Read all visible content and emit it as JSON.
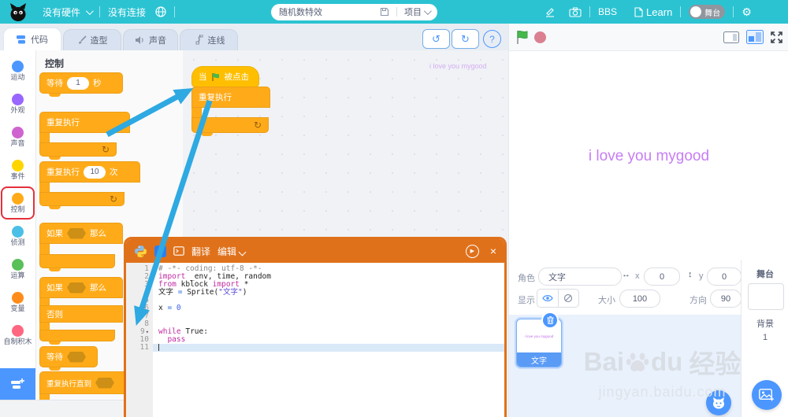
{
  "topbar": {
    "hardware": "没有硬件",
    "connection": "没有连接",
    "project_name": "随机数特效",
    "project_menu": "项目",
    "bbs": "BBS",
    "learn": "Learn",
    "stage_toggle": "舞台"
  },
  "tabs": {
    "code": "代码",
    "costume": "造型",
    "sound": "声音",
    "connect": "连线"
  },
  "toolbar": {
    "help": "?"
  },
  "categories": [
    {
      "en": "motion",
      "label": "运动",
      "color": "#4C97FF"
    },
    {
      "en": "looks",
      "label": "外观",
      "color": "#9966FF"
    },
    {
      "en": "sound",
      "label": "声音",
      "color": "#CF63CF"
    },
    {
      "en": "events",
      "label": "事件",
      "color": "#FFD500"
    },
    {
      "en": "control",
      "label": "控制",
      "color": "#FFAB19",
      "highlight": true
    },
    {
      "en": "sensing",
      "label": "侦测",
      "color": "#4CBFE6"
    },
    {
      "en": "operators",
      "label": "运算",
      "color": "#59C059"
    },
    {
      "en": "variables",
      "label": "变量",
      "color": "#FF8C1A"
    },
    {
      "en": "myblocks",
      "label": "自制积木",
      "color": "#FF6680"
    }
  ],
  "palette": {
    "header": "控制",
    "wait_secs": {
      "pre": "等待",
      "val": "1",
      "suf": "秒"
    },
    "forever": "重复执行",
    "repeat": {
      "pre": "重复执行",
      "val": "10",
      "suf": "次"
    },
    "if_block": {
      "pre": "如果",
      "suf": "那么"
    },
    "ifelse": {
      "pre": "如果",
      "suf": "那么",
      "els": "否则"
    },
    "wait_until": "等待",
    "repeat_until": "重复执行直到"
  },
  "script": {
    "hat_pre": "当",
    "hat_suf": "被点击",
    "forever": "重复执行",
    "ghost": "i love you mygood"
  },
  "editor": {
    "translate": "翻译",
    "edit": "编辑",
    "lines": [
      {
        "n": 1,
        "segs": [
          [
            "# -*- coding: utf-8 -*-",
            "com"
          ]
        ]
      },
      {
        "n": 2,
        "segs": [
          [
            "import",
            "kw"
          ],
          [
            " _env, time, random",
            "id"
          ]
        ]
      },
      {
        "n": 3,
        "segs": [
          [
            "from",
            "kw"
          ],
          [
            " kblock ",
            "id"
          ],
          [
            "import",
            "kw"
          ],
          [
            " *",
            "id"
          ]
        ]
      },
      {
        "n": 4,
        "segs": [
          [
            "文字 ",
            "id"
          ],
          [
            "=",
            "op"
          ],
          [
            " Sprite(",
            "id"
          ],
          [
            "\"文字\"",
            "str"
          ],
          [
            ")",
            "id"
          ]
        ]
      },
      {
        "n": 5,
        "segs": []
      },
      {
        "n": 6,
        "segs": [
          [
            "x ",
            "id"
          ],
          [
            "=",
            "op"
          ],
          [
            " ",
            "id"
          ],
          [
            "0",
            "num"
          ]
        ]
      },
      {
        "n": 7,
        "segs": []
      },
      {
        "n": 8,
        "segs": []
      },
      {
        "n": 9,
        "fold": true,
        "segs": [
          [
            "while",
            "kw"
          ],
          [
            " ",
            "id"
          ],
          [
            "True",
            "const"
          ],
          [
            ":",
            "id"
          ]
        ]
      },
      {
        "n": 10,
        "segs": [
          [
            "  ",
            "id"
          ],
          [
            "pass",
            "kw"
          ]
        ]
      },
      {
        "n": 11,
        "active": true,
        "segs": []
      }
    ]
  },
  "stage": {
    "text": "i love you mygood"
  },
  "sprite": {
    "role_label": "角色",
    "name": "文字",
    "x_label": "x",
    "x": "0",
    "y_label": "y",
    "y": "0",
    "show_label": "显示",
    "size_label": "大小",
    "size": "100",
    "dir_label": "方向",
    "dir": "90",
    "card_name": "文字",
    "card_text": "i love you mygood"
  },
  "stage_col": {
    "stage": "舞台",
    "backdrop": "背景",
    "count": "1"
  },
  "watermark": {
    "b1": "Bai",
    "b2": "du",
    "b3": "经验",
    "line2": "jingyan.baidu.com"
  },
  "icons": {
    "undo": "↺",
    "redo": "↻",
    "loop": "↻",
    "gear": "⚙",
    "check": "✓",
    "close": "×",
    "play": "▶",
    "harrow": "↔",
    "varrow": "↕"
  },
  "colors": {
    "accent": "#4C97FF",
    "block": "#FFAB19",
    "topbar": "#2BC3D2",
    "editor_orange": "#E0711B",
    "arrow": "#2EA9E2",
    "stage_text": "#C77DF5"
  }
}
